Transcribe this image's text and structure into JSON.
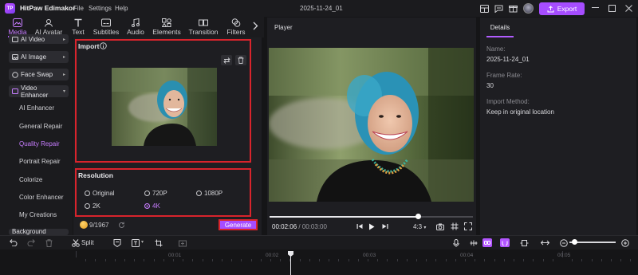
{
  "app": {
    "title": "HitPaw Edimakor",
    "project_name": "2025-11-24_01"
  },
  "menu": [
    "File",
    "Settings",
    "Help"
  ],
  "export_label": "Export",
  "toolbar_tabs": [
    {
      "label": "Media",
      "icon": "media-icon"
    },
    {
      "label": "AI Avatar",
      "icon": "ai-avatar-icon"
    },
    {
      "label": "Text",
      "icon": "text-icon"
    },
    {
      "label": "Subtitles",
      "icon": "subtitles-icon"
    },
    {
      "label": "Audio",
      "icon": "audio-icon"
    },
    {
      "label": "Elements",
      "icon": "elements-icon"
    },
    {
      "label": "Transition",
      "icon": "transition-icon"
    },
    {
      "label": "Filters",
      "icon": "filters-icon"
    }
  ],
  "sidebar": {
    "buttons": [
      "AI Video",
      "AI Image",
      "Face Swap",
      "Video Enhancer",
      "Background"
    ],
    "sub_items": [
      "AI Enhancer",
      "General Repair",
      "Quality Repair",
      "Portrait Repair",
      "Colorize",
      "Color Enhancer",
      "My Creations"
    ],
    "active_sub": "Quality Repair"
  },
  "import": {
    "title": "Import"
  },
  "resolution": {
    "title": "Resolution",
    "options": [
      "Original",
      "720P",
      "1080P",
      "2K",
      "4K"
    ],
    "selected": "4K"
  },
  "credits": "9/1967",
  "generate_label": "Generate",
  "player": {
    "label": "Player",
    "current_time": "00:02:06",
    "separator": " / ",
    "total_time": "00:03:00",
    "ratio": "4:3",
    "progress": 0.73
  },
  "details": {
    "tab": "Details",
    "fields": [
      {
        "label": "Name:",
        "value": "2025-11-24_01"
      },
      {
        "label": "Frame Rate:",
        "value": "30"
      },
      {
        "label": "Import Method:",
        "value": "Keep in original location"
      }
    ]
  },
  "timeline": {
    "split_label": "Split",
    "ruler_labels": [
      "00:01",
      "00:02",
      "00:03",
      "00:04",
      "00:05"
    ]
  },
  "colors": {
    "accent": "#a64dff",
    "highlight": "#d8242c",
    "bg": "#151517"
  }
}
